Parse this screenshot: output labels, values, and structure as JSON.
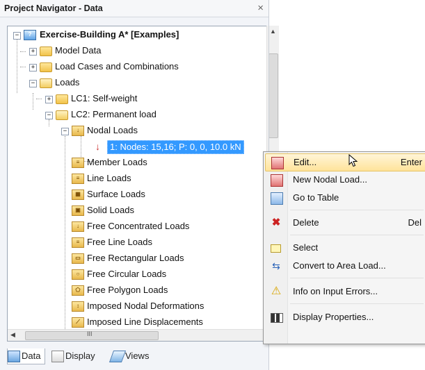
{
  "window": {
    "title": "Project Navigator - Data",
    "close_glyph": "×"
  },
  "tree": {
    "root_label": "Exercise-Building A* [Examples]",
    "model_data": "Model Data",
    "load_cases": "Load Cases and Combinations",
    "loads": "Loads",
    "lc1": "LC1: Self-weight",
    "lc2": "LC2: Permanent load",
    "nodal_loads": "Nodal Loads",
    "selected_item": "1: Nodes: 15,16; P: 0, 0, 10.0 kN",
    "member_loads": "Member Loads",
    "line_loads": "Line Loads",
    "surface_loads": "Surface Loads",
    "solid_loads": "Solid Loads",
    "free_concentrated": "Free Concentrated Loads",
    "free_line": "Free Line Loads",
    "free_rectangular": "Free Rectangular Loads",
    "free_circular": "Free Circular Loads",
    "free_polygon": "Free Polygon Loads",
    "imposed_nodal": "Imposed Nodal Deformations",
    "imposed_line": "Imposed Line Displacements"
  },
  "scrollbar": {
    "h_thumb_glyph": "III"
  },
  "tabs": {
    "data": "Data",
    "display": "Display",
    "views": "Views"
  },
  "context_menu": {
    "edit": "Edit...",
    "edit_shortcut": "Enter",
    "new_nodal": "New Nodal Load...",
    "go_to_table": "Go to Table",
    "delete": "Delete",
    "delete_shortcut": "Del",
    "select": "Select",
    "convert": "Convert to Area Load...",
    "info": "Info on Input Errors...",
    "display_props": "Display Properties..."
  },
  "colors": {
    "selection": "#3399ff",
    "menu_hover": "#ffe39a"
  }
}
